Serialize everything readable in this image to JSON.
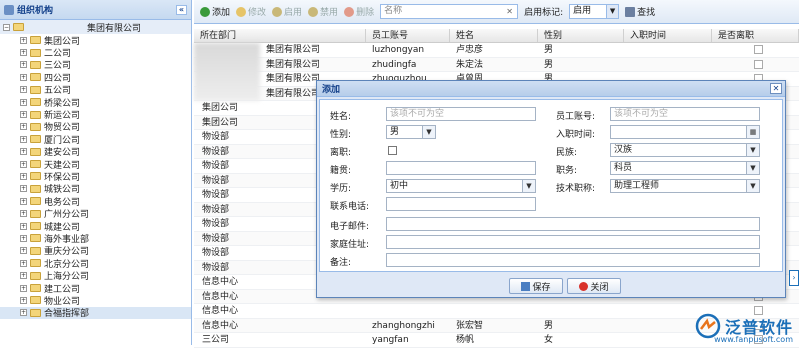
{
  "sidebar": {
    "title": "组织机构",
    "collapse_glyph": "«",
    "root": "集团有限公司",
    "items": [
      "集团公司",
      "二公司",
      "三公司",
      "四公司",
      "五公司",
      "桥梁公司",
      "新运公司",
      "物贸公司",
      "厦门公司",
      "建安公司",
      "天建公司",
      "环保公司",
      "城铁公司",
      "电务公司",
      "广州分公司",
      "城建公司",
      "海外事业部",
      "重庆分公司",
      "北京分公司",
      "上海分公司",
      "建工公司",
      "物业公司",
      "合福指挥部"
    ]
  },
  "toolbar": {
    "add": "添加",
    "edit": "修改",
    "enable": "启用",
    "disable": "禁用",
    "delete": "删除",
    "search_placeholder": "名称",
    "flag_label": "启用标记:",
    "flag_value": "启用",
    "search": "查找"
  },
  "grid": {
    "columns": [
      "所在部门",
      "员工账号",
      "姓名",
      "性别",
      "入职时间",
      "是否离职"
    ],
    "rows": [
      [
        "集团有限公司",
        "luzhongyan",
        "卢忠彦",
        "男",
        "",
        ""
      ],
      [
        "集团有限公司",
        "zhudingfa",
        "朱定法",
        "男",
        "",
        ""
      ],
      [
        "集团有限公司",
        "zhuoguzhou",
        "卓曾周",
        "男",
        "",
        ""
      ],
      [
        "集团有限公司",
        "",
        "",
        "",
        "",
        ""
      ],
      [
        "集团公司",
        "",
        "",
        "",
        "",
        ""
      ],
      [
        "集团公司",
        "",
        "",
        "",
        "",
        ""
      ],
      [
        "物设部",
        "",
        "",
        "",
        "",
        ""
      ],
      [
        "物设部",
        "",
        "",
        "",
        "",
        ""
      ],
      [
        "物设部",
        "",
        "",
        "",
        "",
        ""
      ],
      [
        "物设部",
        "",
        "",
        "",
        "",
        ""
      ],
      [
        "物设部",
        "",
        "",
        "",
        "",
        ""
      ],
      [
        "物设部",
        "",
        "",
        "",
        "",
        ""
      ],
      [
        "物设部",
        "",
        "",
        "",
        "",
        ""
      ],
      [
        "物设部",
        "",
        "",
        "",
        "",
        ""
      ],
      [
        "物设部",
        "",
        "",
        "",
        "",
        ""
      ],
      [
        "物设部",
        "",
        "",
        "",
        "",
        ""
      ],
      [
        "信息中心",
        "",
        "",
        "",
        "",
        ""
      ],
      [
        "信息中心",
        "",
        "",
        "",
        "",
        ""
      ],
      [
        "信息中心",
        "",
        "",
        "",
        "",
        ""
      ],
      [
        "信息中心",
        "zhanghongzhi",
        "张宏智",
        "男",
        "",
        ""
      ],
      [
        "三公司",
        "yangfan",
        "杨帆",
        "女",
        "",
        ""
      ]
    ]
  },
  "dialog": {
    "title": "添加",
    "close_glyph": "✕",
    "name_label": "姓名:",
    "name_placeholder": "该项不可为空",
    "account_label": "员工账号:",
    "account_placeholder": "该项不可为空",
    "gender_label": "性别:",
    "gender_value": "男",
    "hire_label": "入职时间:",
    "resigned_label": "离职:",
    "ethnic_label": "民族:",
    "ethnic_value": "汉族",
    "native_label": "籍贯:",
    "duty_label": "职务:",
    "duty_value": "科员",
    "edu_label": "学历:",
    "edu_value": "初中",
    "title_label": "技术职称:",
    "title_value": "助理工程师",
    "phone_label": "联系电话:",
    "email_label": "电子邮件:",
    "address_label": "家庭住址:",
    "note_label": "备注:",
    "save": "保存",
    "close": "关闭"
  },
  "brand": {
    "name": "泛普软件",
    "url": "www.fanpusoft.com"
  },
  "colors": {
    "accent": "#15428b",
    "border": "#99bbe8",
    "brand": "#1b6fb8"
  }
}
